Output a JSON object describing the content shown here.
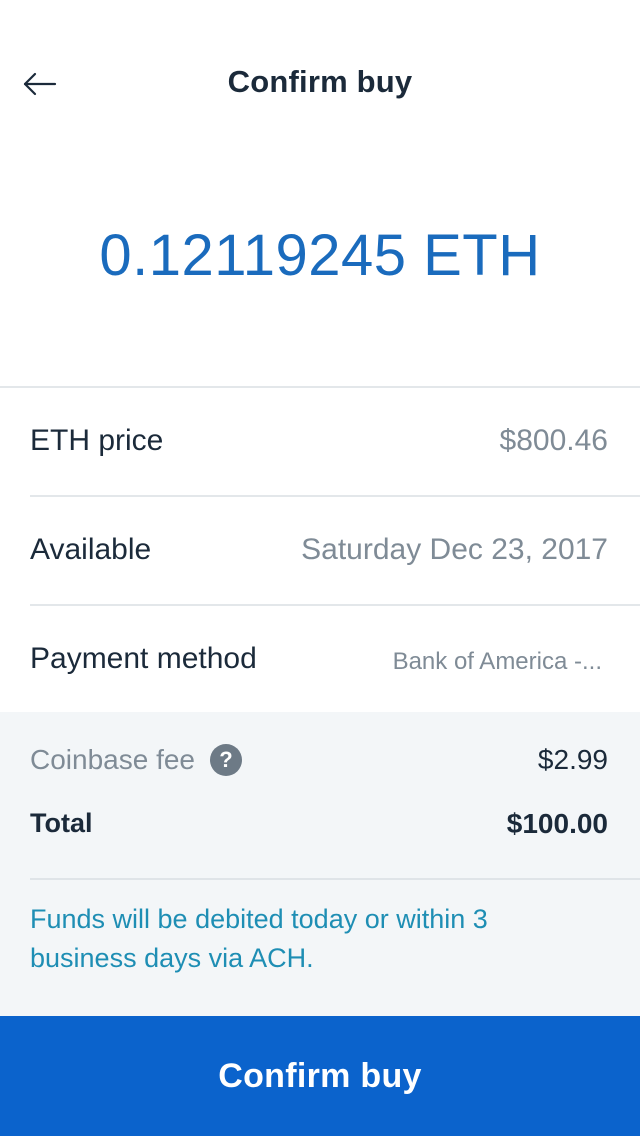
{
  "header": {
    "back_icon": "arrow-left-icon",
    "title": "Confirm buy"
  },
  "amount": "0.12119245 ETH",
  "details": [
    {
      "label": "ETH price",
      "value": "$800.46"
    },
    {
      "label": "Available",
      "value": "Saturday Dec 23, 2017"
    },
    {
      "label": "Payment method",
      "value": "Bank of America -..."
    }
  ],
  "summary": {
    "fee_label": "Coinbase fee",
    "fee_help_icon": "question-circle-icon",
    "fee_help_glyph": "?",
    "fee_value": "$2.99",
    "total_label": "Total",
    "total_value": "$100.00",
    "notice": "Funds will be debited today or within 3 business days via ACH."
  },
  "confirm_button": {
    "label": "Confirm buy",
    "color": "#0b63cc"
  },
  "colors": {
    "accent": "#1a6bbd",
    "notice": "#1e8eb4",
    "text_dark": "#1b2a3a",
    "text_muted": "#7f8b96"
  }
}
